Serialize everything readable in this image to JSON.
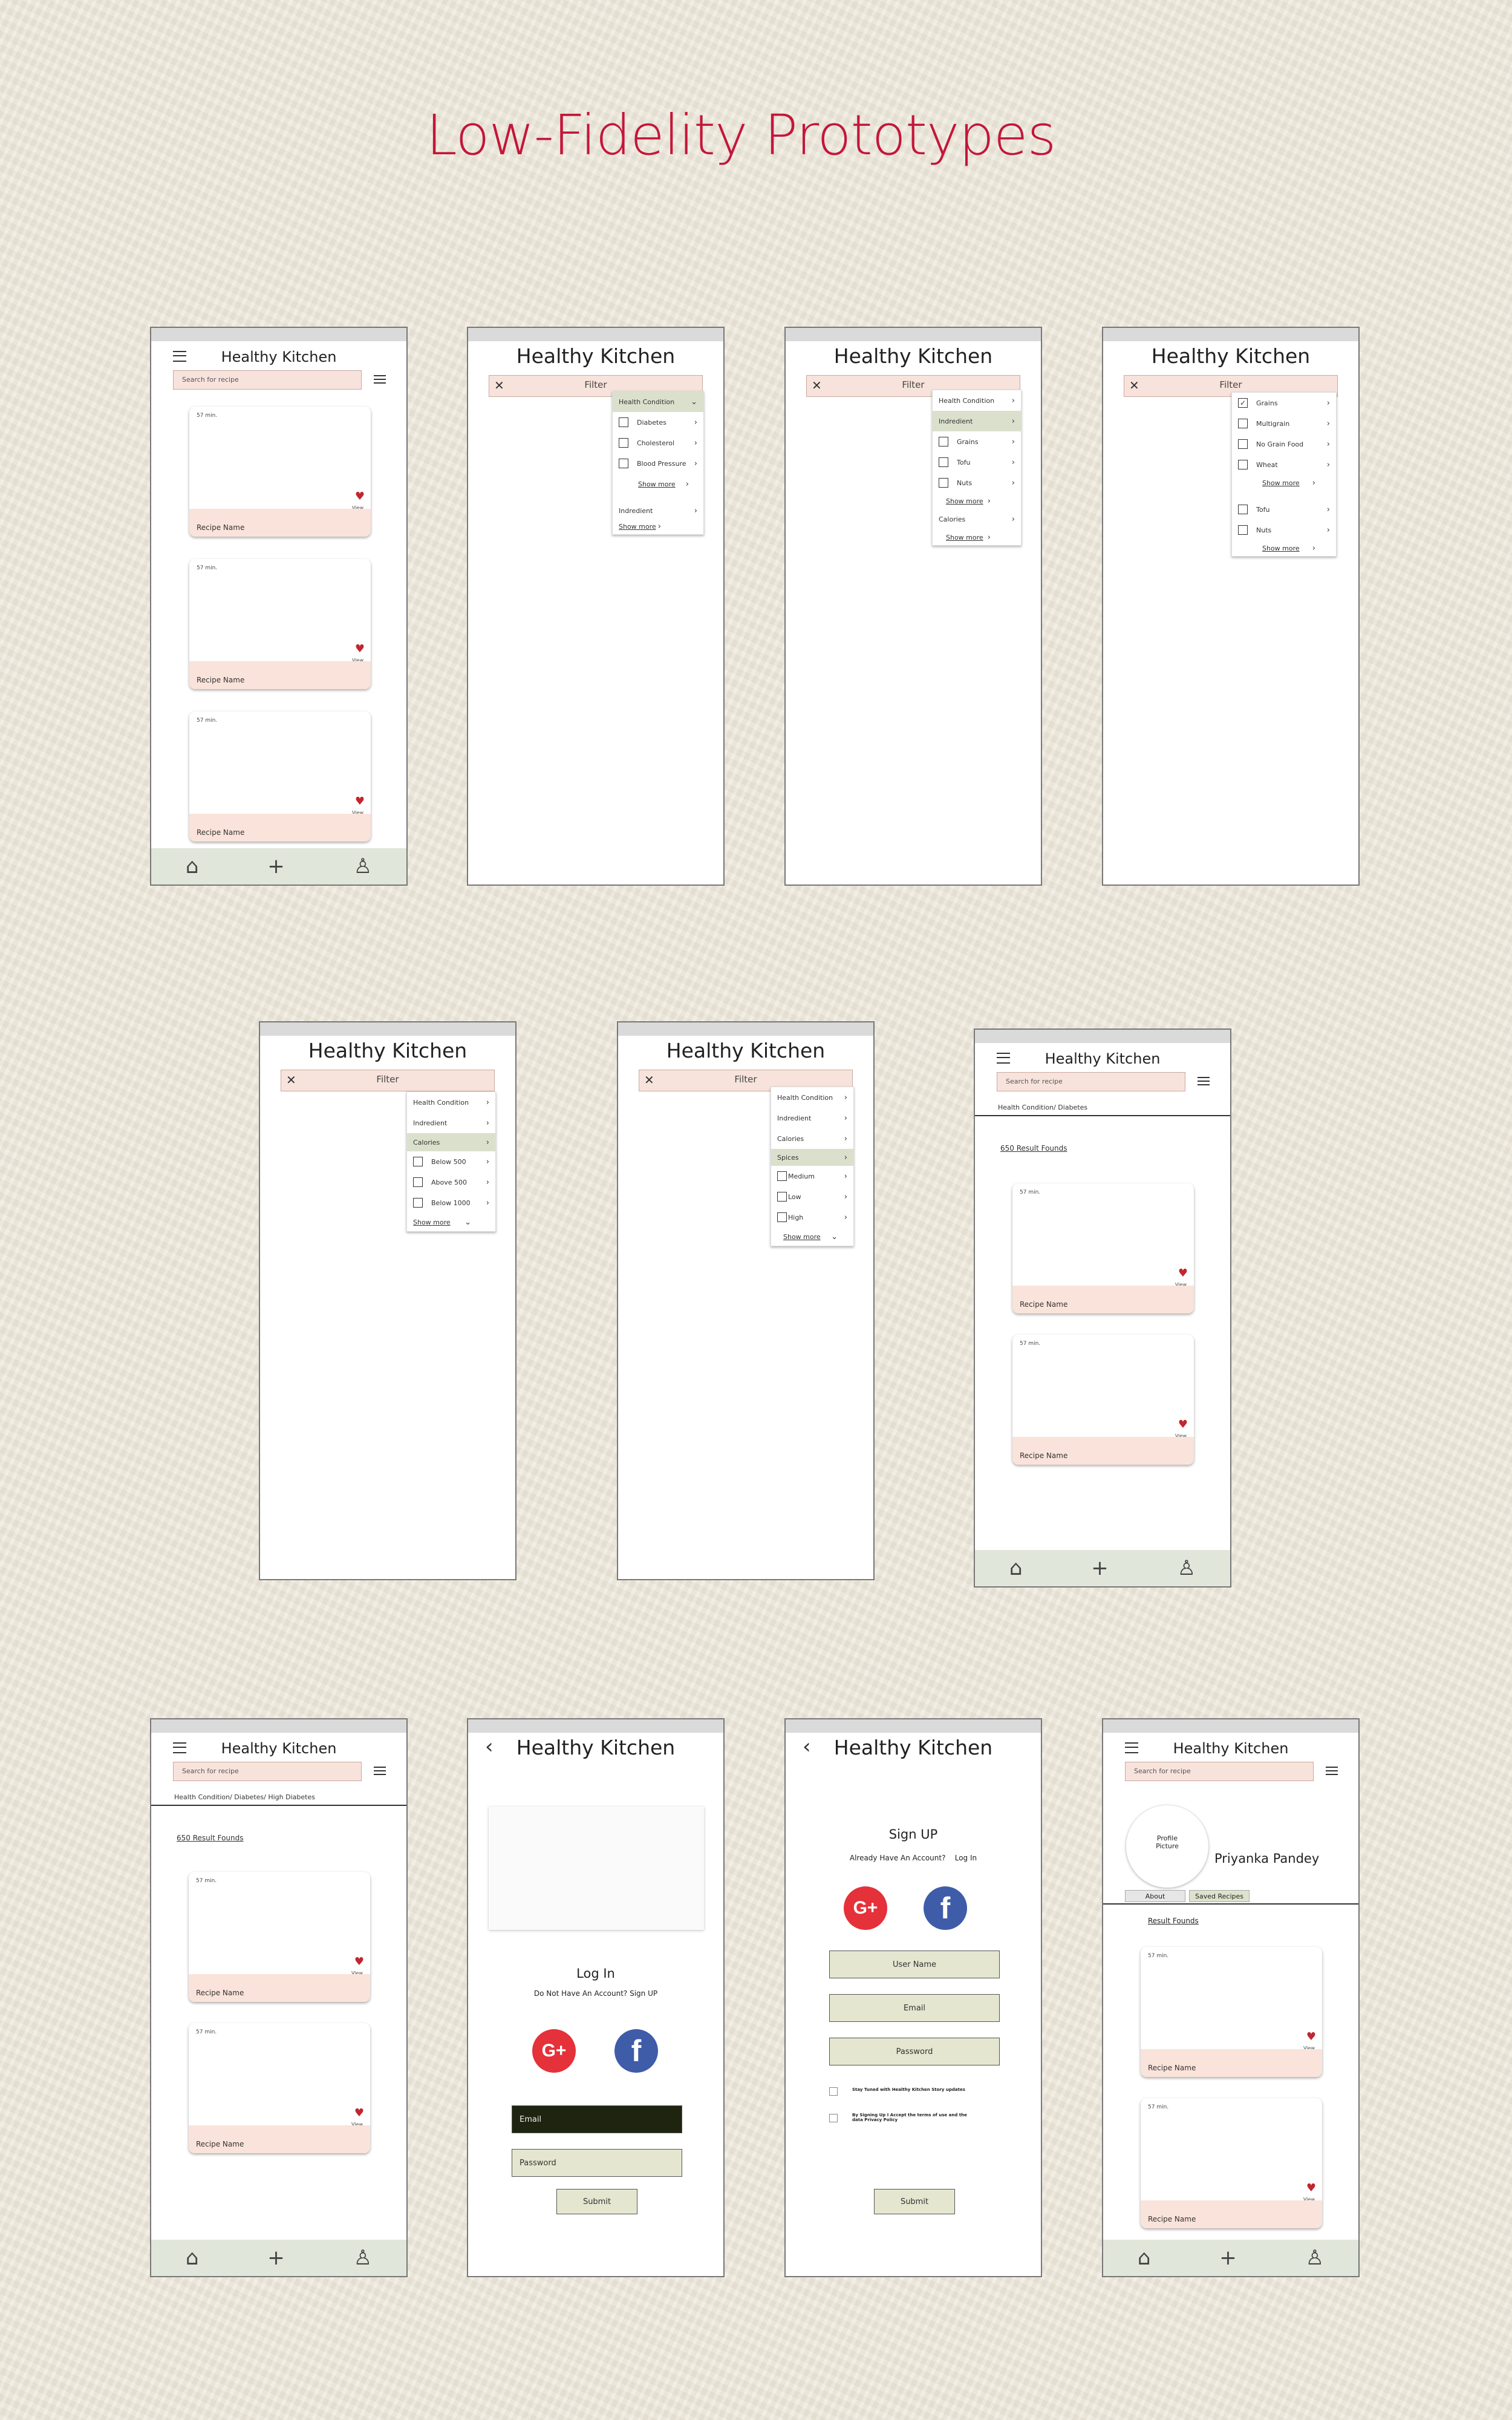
{
  "page_title": "Low-Fidelity Prototypes",
  "app": {
    "name": "Healthy Kitchen",
    "search_placeholder": "Search for recipe",
    "filter_label": "Filter",
    "card": {
      "time": "57 min.",
      "view": "View",
      "name": "Recipe Name"
    }
  },
  "s2": {
    "rows": [
      "Health Condition",
      "Diabetes",
      "Cholesterol",
      "Blood Pressure",
      "Show more",
      "Indredient",
      "Show more"
    ]
  },
  "s3": {
    "rows": [
      "Health Condition",
      "Indredient",
      "Grains",
      "Tofu",
      "Nuts",
      "Show more",
      "Calories",
      "Show more"
    ]
  },
  "s4": {
    "rows": [
      "Grains",
      "Multigrain",
      "No Grain Food",
      "Wheat",
      "Show more",
      "Tofu",
      "Nuts",
      "Show more"
    ]
  },
  "s5": {
    "rows": [
      "Health Condition",
      "Indredient",
      "Calories",
      "Below 500",
      "Above 500",
      "Below 1000",
      "Show more"
    ]
  },
  "s6": {
    "rows": [
      "Health Condition",
      "Indredient",
      "Calories",
      "Spices",
      "Medium",
      "Low",
      "High",
      "Show more"
    ]
  },
  "s7": {
    "crumb": "Health Condition/ Diabetes",
    "results": "650 Result Founds"
  },
  "s8": {
    "crumb": "Health Condition/ Diabetes/ High Diabetes",
    "results": "650 Result Founds"
  },
  "login": {
    "title": "Log In",
    "prompt": "Do Not Have An Account? Sign UP",
    "email": "Email",
    "password": "Password",
    "submit": "Submit"
  },
  "signup": {
    "title": "Sign UP",
    "prompt": "Already Have An Account?    Log In",
    "username": "User Name",
    "email": "Email",
    "password": "Password",
    "opt1": "Stay Tuned with Healthy Kitchen Story updates",
    "opt2": "By Signing Up I Accept the terms of use and the data Privacy Policy",
    "submit": "Submit"
  },
  "profile": {
    "picture": "Profile Picture",
    "user": "Priyanka Pandey",
    "tab_about": "About",
    "tab_saved": "Saved Recipes",
    "results": "Result Founds"
  }
}
